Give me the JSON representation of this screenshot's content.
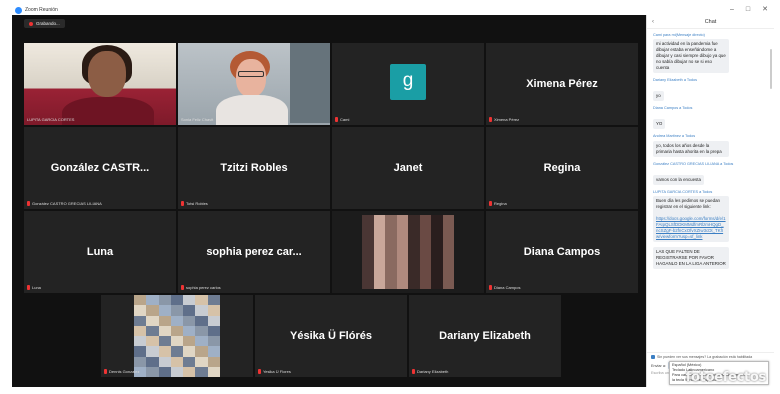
{
  "window": {
    "title": "Zoom Reunión",
    "controls": [
      "–",
      "□",
      "✕"
    ]
  },
  "recording": {
    "label": "Grabando..."
  },
  "tiles": [
    {
      "id": "t1",
      "display": "",
      "name": "LUPITA GARCIA CORTES",
      "kind": "video"
    },
    {
      "id": "t2",
      "display": "",
      "name": "Sonia Feliz Chavit",
      "kind": "video"
    },
    {
      "id": "t3",
      "display": "",
      "name": "Cami",
      "kind": "avatar",
      "avatar_letter": "g",
      "avatar_color": "#1a9ea5"
    },
    {
      "id": "t4",
      "display": "Ximena Pérez",
      "name": "Ximena Pérez",
      "kind": "name"
    },
    {
      "id": "t5",
      "display": "González  CASTR...",
      "name": "González CASTRO GRECIAS LILIANA",
      "kind": "name"
    },
    {
      "id": "t6",
      "display": "Tzitzi Robles",
      "name": "Totsi Robles",
      "kind": "name"
    },
    {
      "id": "t7",
      "display": "Janet",
      "name": "",
      "kind": "name"
    },
    {
      "id": "t8",
      "display": "Regina",
      "name": "Regina",
      "kind": "name"
    },
    {
      "id": "t9",
      "display": "Luna",
      "name": "Luna",
      "kind": "name"
    },
    {
      "id": "t10",
      "display": "sophia perez car...",
      "name": "sophia perez carlos",
      "kind": "name"
    },
    {
      "id": "t11",
      "display": "",
      "name": "",
      "kind": "pixelated"
    },
    {
      "id": "t12",
      "display": "Diana Campos",
      "name": "Diana Campos",
      "kind": "name"
    },
    {
      "id": "t13",
      "display": "",
      "name": "Dennis Gonzalez",
      "kind": "pixelated"
    },
    {
      "id": "t14",
      "display": "Yésika Ü Flórés",
      "name": "Yesika Ü Flores",
      "kind": "name"
    },
    {
      "id": "t15",
      "display": "Dariany Elizabeth",
      "name": "Dariany Elizabeth",
      "kind": "name"
    }
  ],
  "chat": {
    "header": "Chat",
    "messages": [
      {
        "sender": "Cami para mi(Mensaje directo)",
        "text": "mi actividad en la pandemia fue dibujar estaba enseñándome a dibujar y casi siempre dibujo  ya que no sabía dibujar  no se si eso cuenta"
      },
      {
        "sender": "Dariany Elizabeth a Todos",
        "text": "yo"
      },
      {
        "sender": "Diana Campos a Todos",
        "text": "YO"
      },
      {
        "sender": "Andrea Martinez a Todos",
        "text": "yo, todos los años desde la primaria hasta ahorita en la prepa"
      },
      {
        "sender": "González CASTRO GRECIAS LILIANA a Todos",
        "text": "vamos con la encuesta"
      },
      {
        "sender": "LUPITA GARCIA CORTES a Todos",
        "text": "Buen día les pedimos se puedan registrar en el siguiente link:",
        "link": "https://docs.google.com/forms/d/e/1FAIpQLSfDDKMMdfmRlzmHQgD_ncSZgF-b2fnCxOfvXZIw3cDt_TKfIw/viewform?usp=sf_link"
      },
      {
        "sender": "",
        "text": "LAS QUE FALTEN DE REGISTRARSE POR FAVOR HAGANLO EN LA LIGA ANTERIOR"
      }
    ],
    "notice": "Sin pueden ver sus mensajes? La grabación está habilitada",
    "to_label": "Enviar a:",
    "to_value": "Cami ▾",
    "to_suffix": "(Mensaje directo)",
    "to_icons": "⬚ ☺ ···",
    "input_placeholder": "Escriba un mensaje aquí...",
    "popup_lines": [
      "Español (México)",
      "Teclado Latinoamericano",
      "",
      "Para cambiar el método de entrada, presione",
      "la tecla Windows+Espacio."
    ]
  },
  "watermark": "fotoefectos"
}
